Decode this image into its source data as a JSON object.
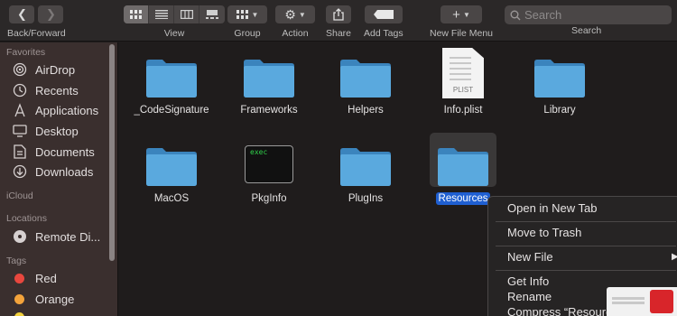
{
  "toolbar": {
    "back_forward_label": "Back/Forward",
    "view_label": "View",
    "group_label": "Group",
    "action_label": "Action",
    "share_label": "Share",
    "add_tags_label": "Add Tags",
    "new_file_menu_label": "New File Menu",
    "search_label": "Search",
    "search_placeholder": "Search"
  },
  "sidebar": {
    "favorites_heading": "Favorites",
    "favorites": [
      {
        "label": "AirDrop",
        "icon": "airdrop-icon"
      },
      {
        "label": "Recents",
        "icon": "clock-icon"
      },
      {
        "label": "Applications",
        "icon": "applications-icon"
      },
      {
        "label": "Desktop",
        "icon": "desktop-icon"
      },
      {
        "label": "Documents",
        "icon": "document-icon"
      },
      {
        "label": "Downloads",
        "icon": "download-icon"
      }
    ],
    "icloud_heading": "iCloud",
    "locations_heading": "Locations",
    "locations": [
      {
        "label": "Remote Di...",
        "icon": "disk-icon"
      }
    ],
    "tags_heading": "Tags",
    "tags": [
      {
        "label": "Red",
        "color": "#e8473e"
      },
      {
        "label": "Orange",
        "color": "#f3a33b"
      }
    ]
  },
  "files": [
    {
      "name": "_CodeSignature",
      "type": "folder"
    },
    {
      "name": "Frameworks",
      "type": "folder"
    },
    {
      "name": "Helpers",
      "type": "folder"
    },
    {
      "name": "Info.plist",
      "type": "plist",
      "badge": "PLIST"
    },
    {
      "name": "Library",
      "type": "folder"
    },
    {
      "name": "MacOS",
      "type": "folder"
    },
    {
      "name": "PkgInfo",
      "type": "exec",
      "badge": "exec"
    },
    {
      "name": "PlugIns",
      "type": "folder"
    },
    {
      "name": "Resources",
      "type": "folder",
      "selected": true
    }
  ],
  "context_menu": {
    "items": [
      "Open in New Tab",
      "Move to Trash",
      "New File",
      "Get Info",
      "Rename",
      "Compress “Resources”"
    ]
  },
  "colors": {
    "folder": "#4fa3dc",
    "selection": "#1f5fd1",
    "sidebar_bg": "#3a2f2e",
    "content_bg": "#1f1c1c"
  }
}
